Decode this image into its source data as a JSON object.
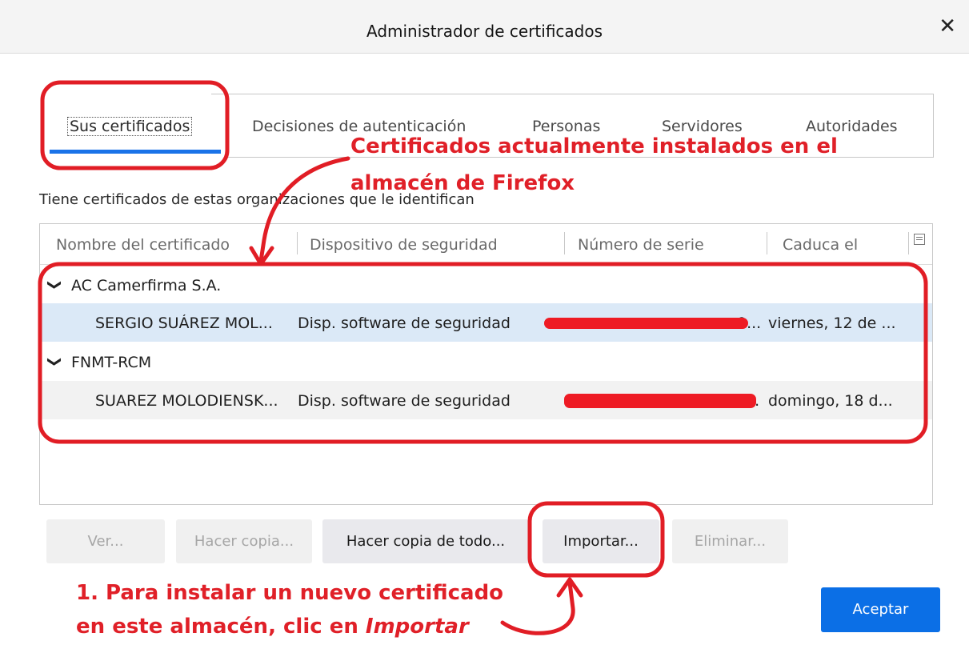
{
  "window": {
    "title": "Administrador de certificados",
    "close_glyph": "✕"
  },
  "tabs": [
    {
      "label": "Sus certificados",
      "active": true
    },
    {
      "label": "Decisiones de autenticación",
      "active": false
    },
    {
      "label": "Personas",
      "active": false
    },
    {
      "label": "Servidores",
      "active": false
    },
    {
      "label": "Autoridades",
      "active": false
    }
  ],
  "intro": "Tiene certificados de estas organizaciones que le identifican",
  "columns": [
    "Nombre del certificado",
    "Dispositivo de seguridad",
    "Número de serie",
    "Caduca el"
  ],
  "column_picker_icon": "column-picker-icon",
  "tree": [
    {
      "group": "AC Camerfirma S.A.",
      "chevron": "❯",
      "cert": {
        "name": "SERGIO SUÁREZ MOL...",
        "device": "Disp. software de seguridad",
        "serial_tail": "9...",
        "expires": "viernes, 12 de ..."
      }
    },
    {
      "group": "FNMT-RCM",
      "chevron": "❯",
      "cert": {
        "name": "SUAREZ MOLODIENSK...",
        "device": "Disp. software de seguridad",
        "serial_tail": "...",
        "expires": "domingo, 18 d..."
      }
    }
  ],
  "buttons": {
    "view": "Ver...",
    "backup": "Hacer copia...",
    "backup_all": "Hacer copia de todo...",
    "import": "Importar...",
    "delete": "Eliminar...",
    "ok": "Aceptar"
  },
  "annotations": {
    "top_line1": "Certificados actualmente instalados en el",
    "top_line2": "almacén de Firefox",
    "bottom_line1": "1. Para instalar un nuevo certificado",
    "bottom_line2_prefix": "en este almacén, clic en",
    "bottom_line2_italic": "Importar"
  },
  "colors": {
    "accent": "#0b6fe6",
    "annotation": "#e02028",
    "selected_row": "#dbe9f7",
    "tab_indicator": "#1a73e8"
  }
}
